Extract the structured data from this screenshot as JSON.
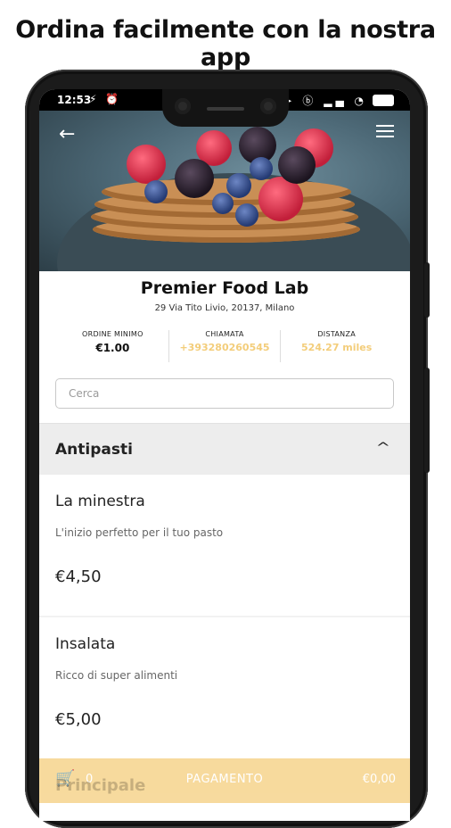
{
  "headline": "Ordina facilmente con la nostra app",
  "status": {
    "time": "12:53",
    "left_icons": "⚡ ⏰",
    "right_icons": "➤ ⓑ ▂▄ ◔"
  },
  "hero": {
    "back_icon": "arrow-left",
    "menu_icon": "hamburger"
  },
  "store": {
    "name": "Premier Food Lab",
    "address": "29 Via Tito Livio, 20137, Milano"
  },
  "stats": {
    "min_order": {
      "label": "ORDINE MINIMO",
      "value": "€1.00"
    },
    "call": {
      "label": "CHIAMATA",
      "value": "+393280260545"
    },
    "distance": {
      "label": "DISTANZA",
      "value": "524.27 miles"
    }
  },
  "search": {
    "placeholder": "Cerca"
  },
  "category": {
    "title": "Antipasti",
    "chevron": "^"
  },
  "items": [
    {
      "name": "La minestra",
      "description": "L'inizio perfetto per il tuo pasto",
      "price": "€4,50"
    },
    {
      "name": "Insalata",
      "description": "Ricco di super alimenti",
      "price": "€5,00"
    }
  ],
  "cart": {
    "count": "0",
    "label": "PAGAMENTO",
    "total": "€0,00",
    "under_label": "Principale"
  },
  "colors": {
    "accent": "#f3cd7a",
    "cart_bar": "#f7d99a"
  }
}
